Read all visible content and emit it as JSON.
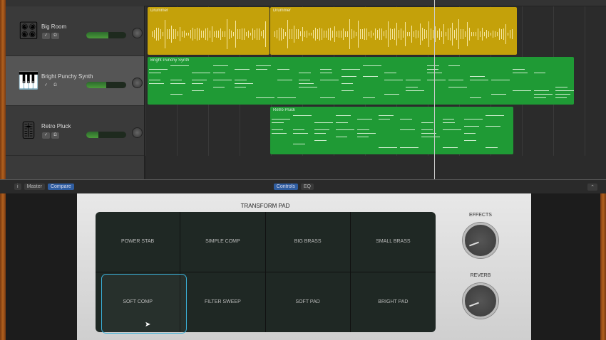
{
  "tracks": [
    {
      "name": "Big Room",
      "icon": "drum-machine-icon",
      "volume": 0.55,
      "color": "#c4a10a"
    },
    {
      "name": "Bright Punchy Synth",
      "icon": "keyboard-icon",
      "volume": 0.5,
      "color": "#1f9a35"
    },
    {
      "name": "Retro Pluck",
      "icon": "synth-icon",
      "volume": 0.3,
      "color": "#1f9a35"
    }
  ],
  "regions": [
    {
      "label": "Drummer",
      "track": 0
    },
    {
      "label": "Drummer",
      "track": 0
    },
    {
      "label": "Bright Punchy Synth",
      "track": 1
    },
    {
      "label": "Retro Pluck",
      "track": 2
    }
  ],
  "bottombar": {
    "info": "i",
    "master": "Master",
    "compare": "Compare",
    "controls": "Controls",
    "eq": "EQ"
  },
  "plugin": {
    "title": "TRANSFORM PAD",
    "pads": [
      "POWER STAB",
      "SIMPLE COMP",
      "BIG BRASS",
      "SMALL BRASS",
      "SOFT COMP",
      "FILTER SWEEP",
      "SOFT PAD",
      "BRIGHT PAD"
    ],
    "selected_pad": "SOFT COMP",
    "effects_label": "EFFECTS",
    "reverb_label": "REVERB"
  },
  "colors": {
    "accent": "#2f5da0",
    "selection": "#3ab0d8"
  }
}
